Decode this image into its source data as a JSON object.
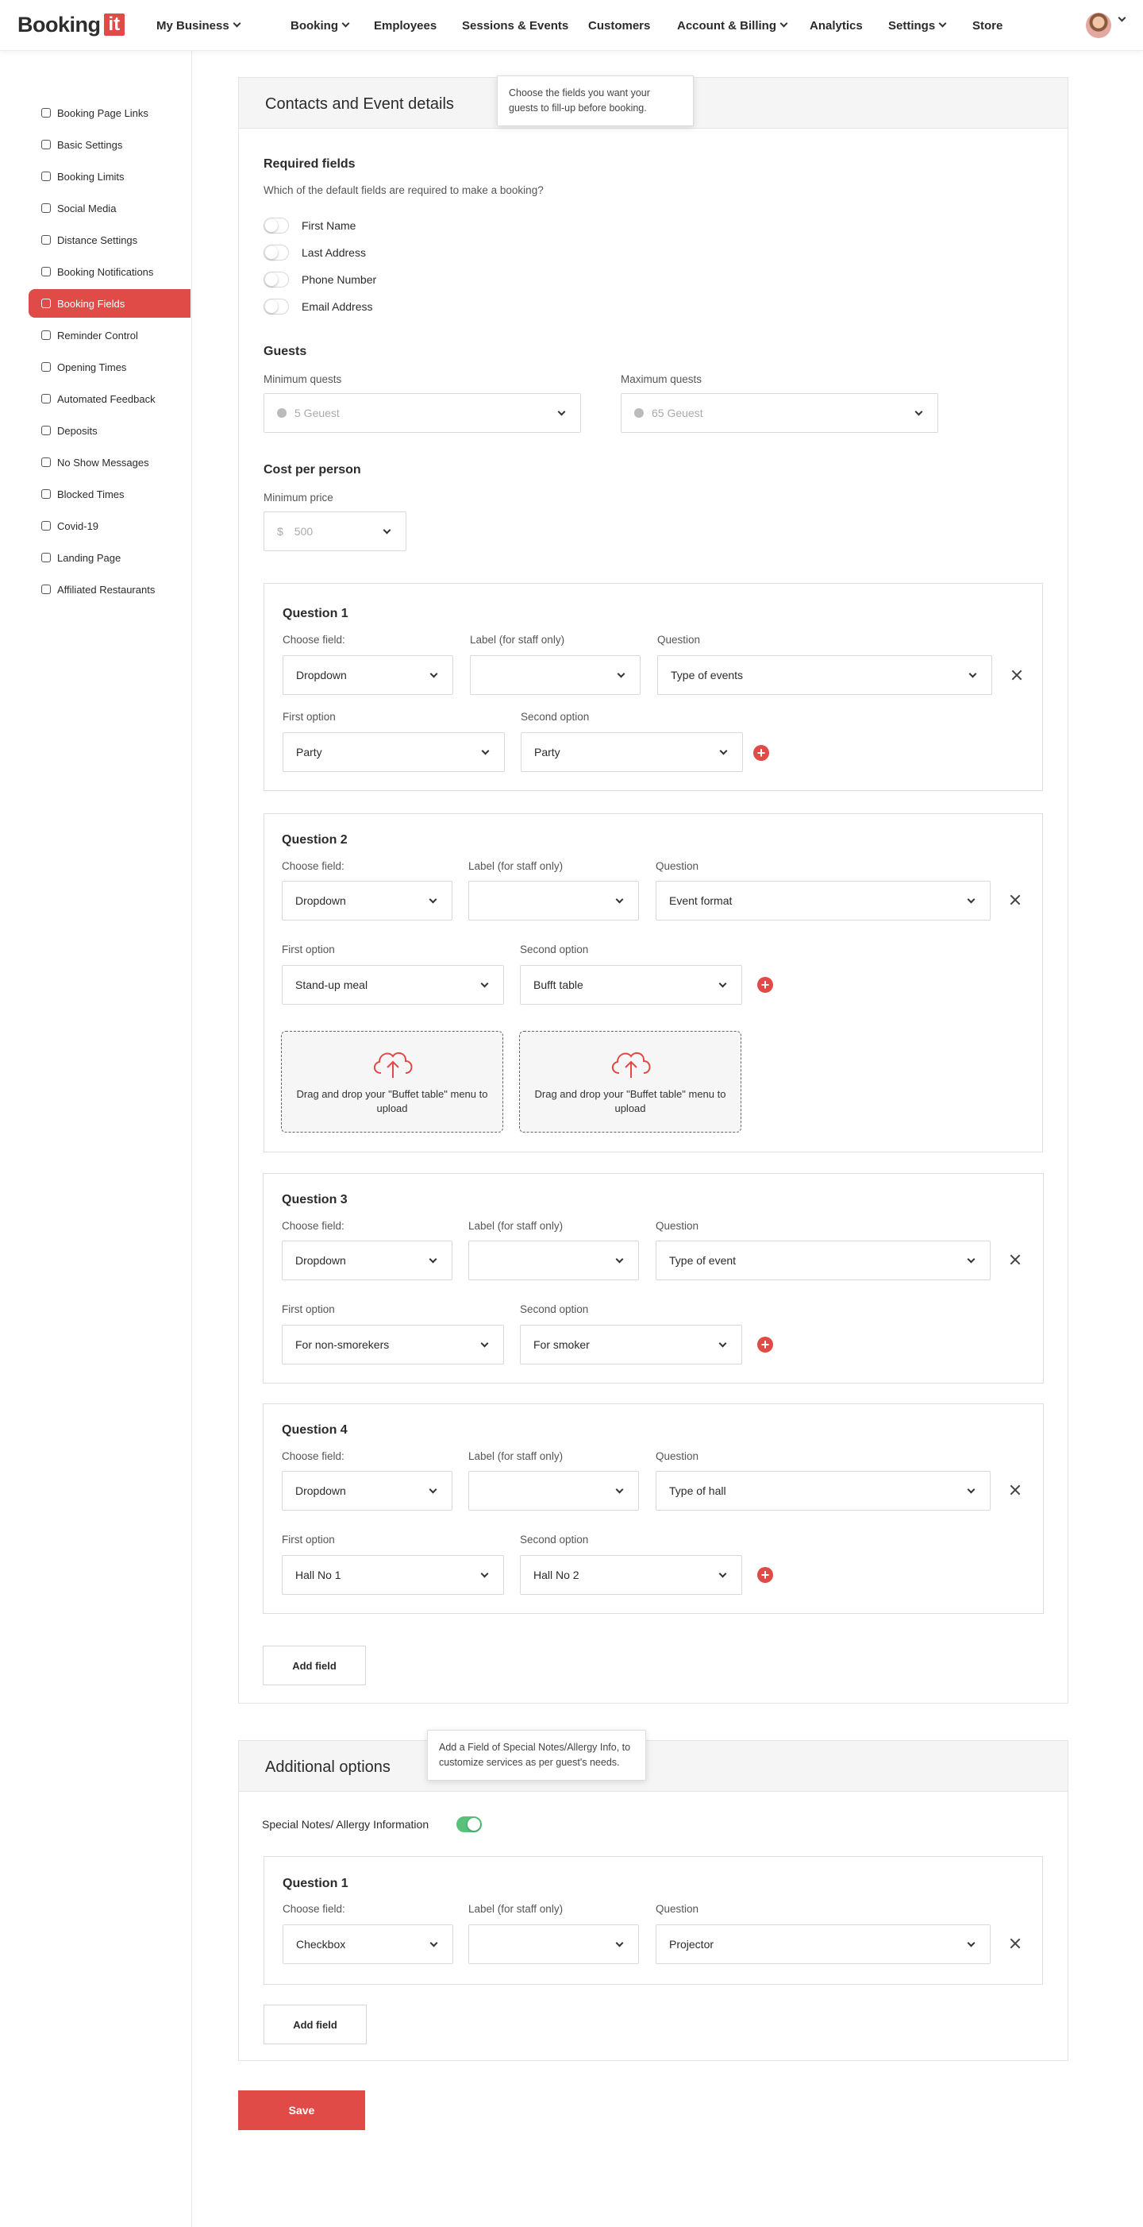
{
  "brand": {
    "name": "Booking",
    "suffix": "it"
  },
  "nav": [
    {
      "label": "My Business",
      "dropdown": true
    },
    {
      "label": "Booking",
      "dropdown": true
    },
    {
      "label": "Employees",
      "dropdown": false
    },
    {
      "label": "Sessions & Events",
      "dropdown": false
    },
    {
      "label": "Customers",
      "dropdown": false
    },
    {
      "label": "Account & Billing",
      "dropdown": true
    },
    {
      "label": "Analytics",
      "dropdown": false
    },
    {
      "label": "Settings",
      "dropdown": true
    },
    {
      "label": "Store",
      "dropdown": false
    }
  ],
  "sidebar": [
    {
      "label": "Booking Page Links",
      "icon": "link-icon"
    },
    {
      "label": "Basic Settings",
      "icon": "gear-icon"
    },
    {
      "label": "Booking Limits",
      "icon": "clock-icon"
    },
    {
      "label": "Social Media",
      "icon": "thumbs-up-icon"
    },
    {
      "label": "Distance Settings",
      "icon": "location-pin-icon"
    },
    {
      "label": "Booking Notifications",
      "icon": "bell-icon"
    },
    {
      "label": "Booking Fields",
      "icon": "fields-icon",
      "active": true
    },
    {
      "label": "Reminder Control",
      "icon": "grid-icon"
    },
    {
      "label": "Opening Times",
      "icon": "clock-icon"
    },
    {
      "label": "Automated Feedback",
      "icon": "feedback-icon"
    },
    {
      "label": "Deposits",
      "icon": "coin-icon"
    },
    {
      "label": "No Show Messages",
      "icon": "message-icon"
    },
    {
      "label": "Blocked Times",
      "icon": "blocked-icon"
    },
    {
      "label": "Covid-19",
      "icon": "virus-icon"
    },
    {
      "label": "Landing Page",
      "icon": "monitor-icon"
    },
    {
      "label": "Affiliated Restaurants",
      "icon": "restaurant-icon"
    }
  ],
  "contacts": {
    "title": "Contacts and Event details",
    "tooltip": "Choose the fields you want your guests to fill-up before booking.",
    "required_title": "Required fields",
    "required_sub": "Which of the default fields are required to make a booking?",
    "fields": [
      {
        "label": "First Name",
        "on": false
      },
      {
        "label": "Last Address",
        "on": false
      },
      {
        "label": "Phone Number",
        "on": false
      },
      {
        "label": "Email Address",
        "on": false
      }
    ],
    "guests_title": "Guests",
    "min_guests_label": "Minimum quests",
    "min_guests_value": "5 Geuest",
    "max_guests_label": "Maximum quests",
    "max_guests_value": "65 Geuest",
    "cost_title": "Cost per person",
    "min_price_label": "Minimum price",
    "currency": "$",
    "min_price_value": "500"
  },
  "labels": {
    "choose_field": "Choose field:",
    "staff_label": "Label (for staff only)",
    "question": "Question",
    "first_option": "First option",
    "second_option": "Second option",
    "add_field": "Add field",
    "upload": "Drag and drop your \"Buffet table\" menu to upload",
    "save": "Save"
  },
  "questions": [
    {
      "title": "Question 1",
      "field": "Dropdown",
      "staff": "",
      "question": "Type of events",
      "opt1": "Party",
      "opt2": "Party"
    },
    {
      "title": "Question 2",
      "field": "Dropdown",
      "staff": "",
      "question": "Event format",
      "opt1": "Stand-up meal",
      "opt2": "Bufft table"
    },
    {
      "title": "Question 3",
      "field": "Dropdown",
      "staff": "",
      "question": "Type of event",
      "opt1": "For non-smorekers",
      "opt2": "For smoker"
    },
    {
      "title": "Question 4",
      "field": "Dropdown",
      "staff": "",
      "question": "Type of hall",
      "opt1": "Hall No 1",
      "opt2": "Hall No 2"
    }
  ],
  "additional": {
    "title": "Additional options",
    "tooltip": "Add a Field of Special Notes/Allergy Info, to customize services as per guest's needs.",
    "toggle_label": "Special Notes/ Allergy Information",
    "toggle_on": true,
    "question": {
      "title": "Question 1",
      "field": "Checkbox",
      "staff": "",
      "question": "Projector"
    }
  },
  "colors": {
    "accent": "#e04a47",
    "toggle_on": "#58c27d"
  }
}
